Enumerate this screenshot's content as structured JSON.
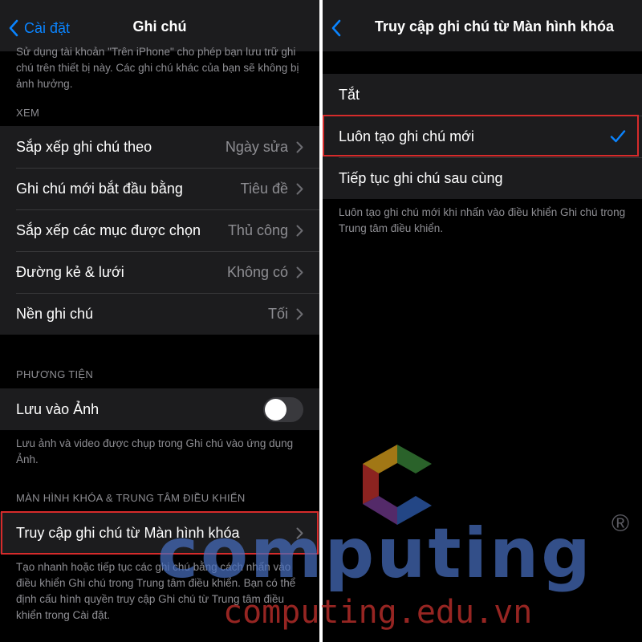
{
  "left": {
    "nav": {
      "back_label": "Cài đặt",
      "title": "Ghi chú"
    },
    "top_caption": "Sử dụng tài khoản \"Trên iPhone\" cho phép bạn lưu trữ ghi chú trên thiết bị này. Các ghi chú khác của bạn sẽ không bị ảnh hưởng.",
    "view_header": "XEM",
    "view_rows": [
      {
        "label": "Sắp xếp ghi chú theo",
        "value": "Ngày sửa"
      },
      {
        "label": "Ghi chú mới bắt đầu bằng",
        "value": "Tiêu đề"
      },
      {
        "label": "Sắp xếp các mục được chọn",
        "value": "Thủ công"
      },
      {
        "label": "Đường kẻ & lưới",
        "value": "Không có"
      },
      {
        "label": "Nền ghi chú",
        "value": "Tối"
      }
    ],
    "media_header": "PHƯƠNG TIỆN",
    "media_row": {
      "label": "Lưu vào Ảnh",
      "toggle_on": false
    },
    "media_caption": "Lưu ảnh và video được chụp trong Ghi chú vào ứng dụng Ảnh.",
    "lock_header": "MÀN HÌNH KHÓA & TRUNG TÂM ĐIỀU KHIỂN",
    "lock_row": {
      "label": "Truy cập ghi chú từ Màn hình khóa"
    },
    "lock_caption": "Tạo nhanh hoặc tiếp tục các ghi chú bằng cách nhấn vào điều khiển Ghi chú trong Trung tâm điều khiển. Bạn có thể định cấu hình quyền truy cập Ghi chú từ Trung tâm điều khiển trong Cài đặt."
  },
  "right": {
    "nav": {
      "title": "Truy cập ghi chú từ Màn hình khóa"
    },
    "options": [
      {
        "label": "Tắt",
        "selected": false
      },
      {
        "label": "Luôn tạo ghi chú mới",
        "selected": true
      },
      {
        "label": "Tiếp tục ghi chú sau cùng",
        "selected": false
      }
    ],
    "caption": "Luôn tạo ghi chú mới khi nhấn vào điều khiển Ghi chú trong Trung tâm điều khiển."
  },
  "watermark": {
    "brand": "computing",
    "domain": "computing.edu.vn",
    "registered_mark": "®"
  },
  "colors": {
    "accent": "#0a84ff",
    "background": "#000000",
    "cell": "#1c1c1e",
    "secondary_text": "#8e8e93",
    "highlight": "#d62b2b"
  },
  "icons": [
    "chevron-left-icon",
    "chevron-right-icon",
    "checkmark-icon",
    "computing-logo-icon"
  ]
}
